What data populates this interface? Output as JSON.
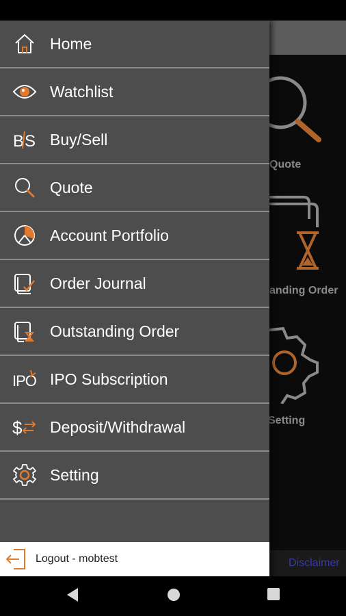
{
  "drawer": {
    "items": [
      {
        "label": "Home",
        "icon": "home-icon"
      },
      {
        "label": "Watchlist",
        "icon": "eye-icon"
      },
      {
        "label": "Buy/Sell",
        "icon": "buy-sell-icon"
      },
      {
        "label": "Quote",
        "icon": "search-icon"
      },
      {
        "label": "Account Portfolio",
        "icon": "pie-chart-icon"
      },
      {
        "label": "Order Journal",
        "icon": "journal-check-icon"
      },
      {
        "label": "Outstanding Order",
        "icon": "hourglass-document-icon"
      },
      {
        "label": "IPO Subscription",
        "icon": "ipo-icon"
      },
      {
        "label": "Deposit/Withdrawal",
        "icon": "dollar-transfer-icon"
      },
      {
        "label": "Setting",
        "icon": "gear-icon"
      }
    ],
    "logout_label": "Logout - mobtest"
  },
  "background": {
    "tiles": [
      "Quote",
      "anding Order",
      "Setting"
    ],
    "disclaimer": "Disclaimer"
  },
  "colors": {
    "drawer_bg": "#4d4d4d",
    "accent": "#e07a2e",
    "text": "#ffffff"
  }
}
